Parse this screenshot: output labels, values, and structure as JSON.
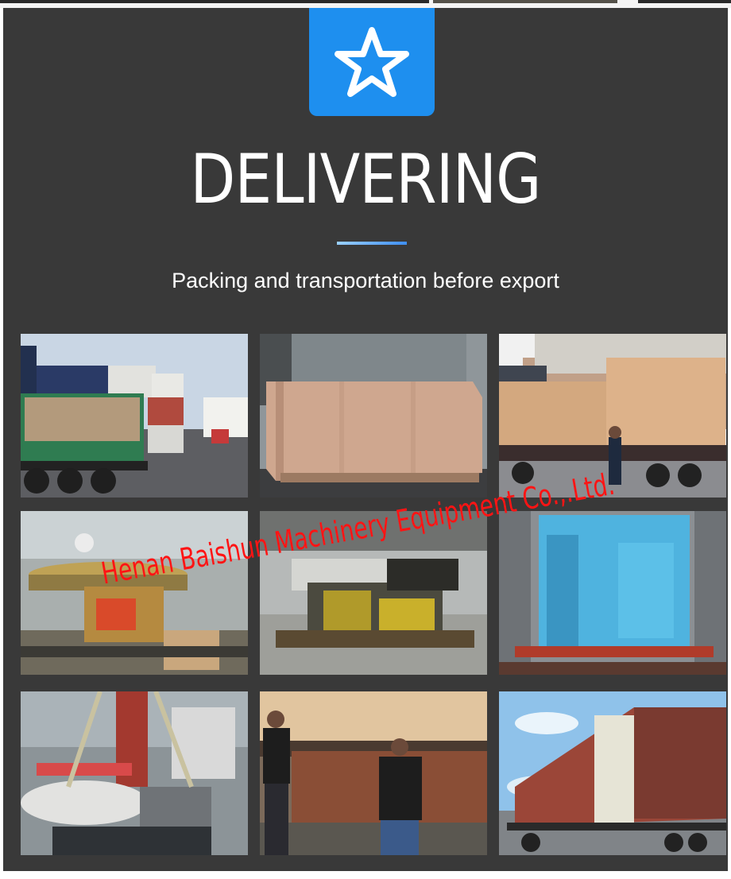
{
  "header": {
    "badge_icon": "star-outline-icon",
    "badge_color": "#1e8fef",
    "title": "DELIVERING",
    "subtitle": "Packing and transportation before export"
  },
  "photos": [
    {
      "name": "photo-truck-with-crates-at-container-yard"
    },
    {
      "name": "photo-plywood-crate-in-warehouse"
    },
    {
      "name": "photo-crates-on-flatbed-truck-with-worker"
    },
    {
      "name": "photo-rotary-table-machine-in-workshop"
    },
    {
      "name": "photo-machine-on-pallet-in-workshop"
    },
    {
      "name": "photo-wrapped-machine-inside-container"
    },
    {
      "name": "photo-crane-lifting-machine"
    },
    {
      "name": "photo-workers-loading-crate"
    },
    {
      "name": "photo-container-truck-loaded"
    }
  ],
  "watermark": "Henan Baishun Machinery Equipment Co.,.Ltd.",
  "colors": {
    "background": "#393939",
    "watermark": "#ff1414",
    "accent_rule": "#3f8ff2"
  }
}
